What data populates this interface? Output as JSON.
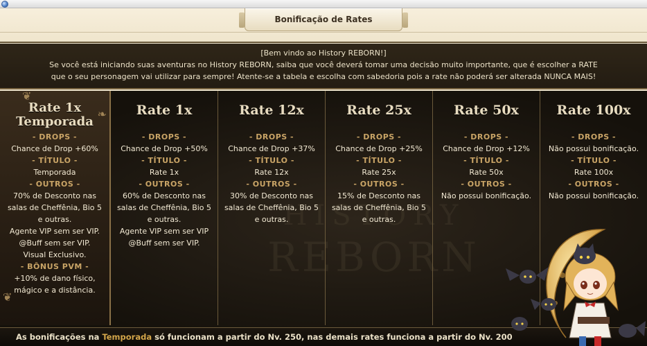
{
  "window": {
    "icon": "app-icon"
  },
  "header": {
    "title": "Bonificação de Rates"
  },
  "intro": {
    "line1": "[Bem vindo ao History REBORN!]",
    "line2": "Se você está iniciando suas aventuras no History REBORN, saiba que você deverá tomar uma decisão muito importante, que é escolher a RATE",
    "line3": "que o seu personagem vai utilizar para sempre! Atente-se a tabela e escolha com sabedoria pois a rate não poderá ser alterada NUNCA MAIS!"
  },
  "watermark": {
    "line1": "HISTORY",
    "line2": "REBORN"
  },
  "columns": [
    {
      "title1": "Rate 1x",
      "title2": "Temporada",
      "drops_label": "- DROPS -",
      "drops": "Chance de Drop +60%",
      "titulo_label": "- TÍTULO -",
      "titulo": "Temporada",
      "outros_label": "- OUTROS -",
      "outros": [
        "70% de Desconto nas",
        "salas de Cheffênia, Bio 5",
        "e outras.",
        "Agente VIP sem ser VIP.",
        "@Buff sem ser VIP.",
        "Visual Exclusivo."
      ],
      "bonus_label": "- BÔNUS PVM -",
      "bonus": [
        "+10% de dano físico,",
        "mágico e a distância."
      ]
    },
    {
      "title1": "Rate 1x",
      "drops_label": "- DROPS -",
      "drops": "Chance de Drop +50%",
      "titulo_label": "- TÍTULO -",
      "titulo": "Rate 1x",
      "outros_label": "- OUTROS -",
      "outros": [
        "60% de Desconto nas",
        "salas de Cheffênia, Bio 5",
        "e outras.",
        "Agente VIP sem ser VIP",
        "@Buff sem ser VIP."
      ]
    },
    {
      "title1": "Rate 12x",
      "drops_label": "- DROPS -",
      "drops": "Chance de Drop +37%",
      "titulo_label": "- TÍTULO -",
      "titulo": "Rate 12x",
      "outros_label": "- OUTROS -",
      "outros": [
        "30% de Desconto nas",
        "salas de Cheffênia, Bio 5",
        "e outras."
      ]
    },
    {
      "title1": "Rate 25x",
      "drops_label": "- DROPS -",
      "drops": "Chance de Drop +25%",
      "titulo_label": "- TÍTULO -",
      "titulo": "Rate 25x",
      "outros_label": "- OUTROS -",
      "outros": [
        "15% de Desconto nas",
        "salas de Cheffênia, Bio 5",
        "e outras."
      ]
    },
    {
      "title1": "Rate 50x",
      "drops_label": "- DROPS -",
      "drops": "Chance de Drop +12%",
      "titulo_label": "- TÍTULO -",
      "titulo": "Rate 50x",
      "outros_label": "- OUTROS -",
      "outros": [
        "Não possui bonificação."
      ]
    },
    {
      "title1": "Rate 100x",
      "drops_label": "- DROPS -",
      "drops": "Não possui bonificação.",
      "titulo_label": "- TÍTULO -",
      "titulo": "Rate 100x",
      "outros_label": "- OUTROS -",
      "outros": [
        "Não possui bonificação."
      ]
    }
  ],
  "footer": {
    "before": "As bonificações na ",
    "highlight": "Temporada",
    "after": " só funcionam a partir do Nv. 250, nas demais rates funciona a partir do Nv. 200"
  },
  "colors": {
    "accent": "#c9a466",
    "highlight": "#d4a64a",
    "panel": "#2f2618"
  },
  "icons": [
    "app-icon",
    "ornament-corner-icon",
    "mascot-character-icon"
  ]
}
